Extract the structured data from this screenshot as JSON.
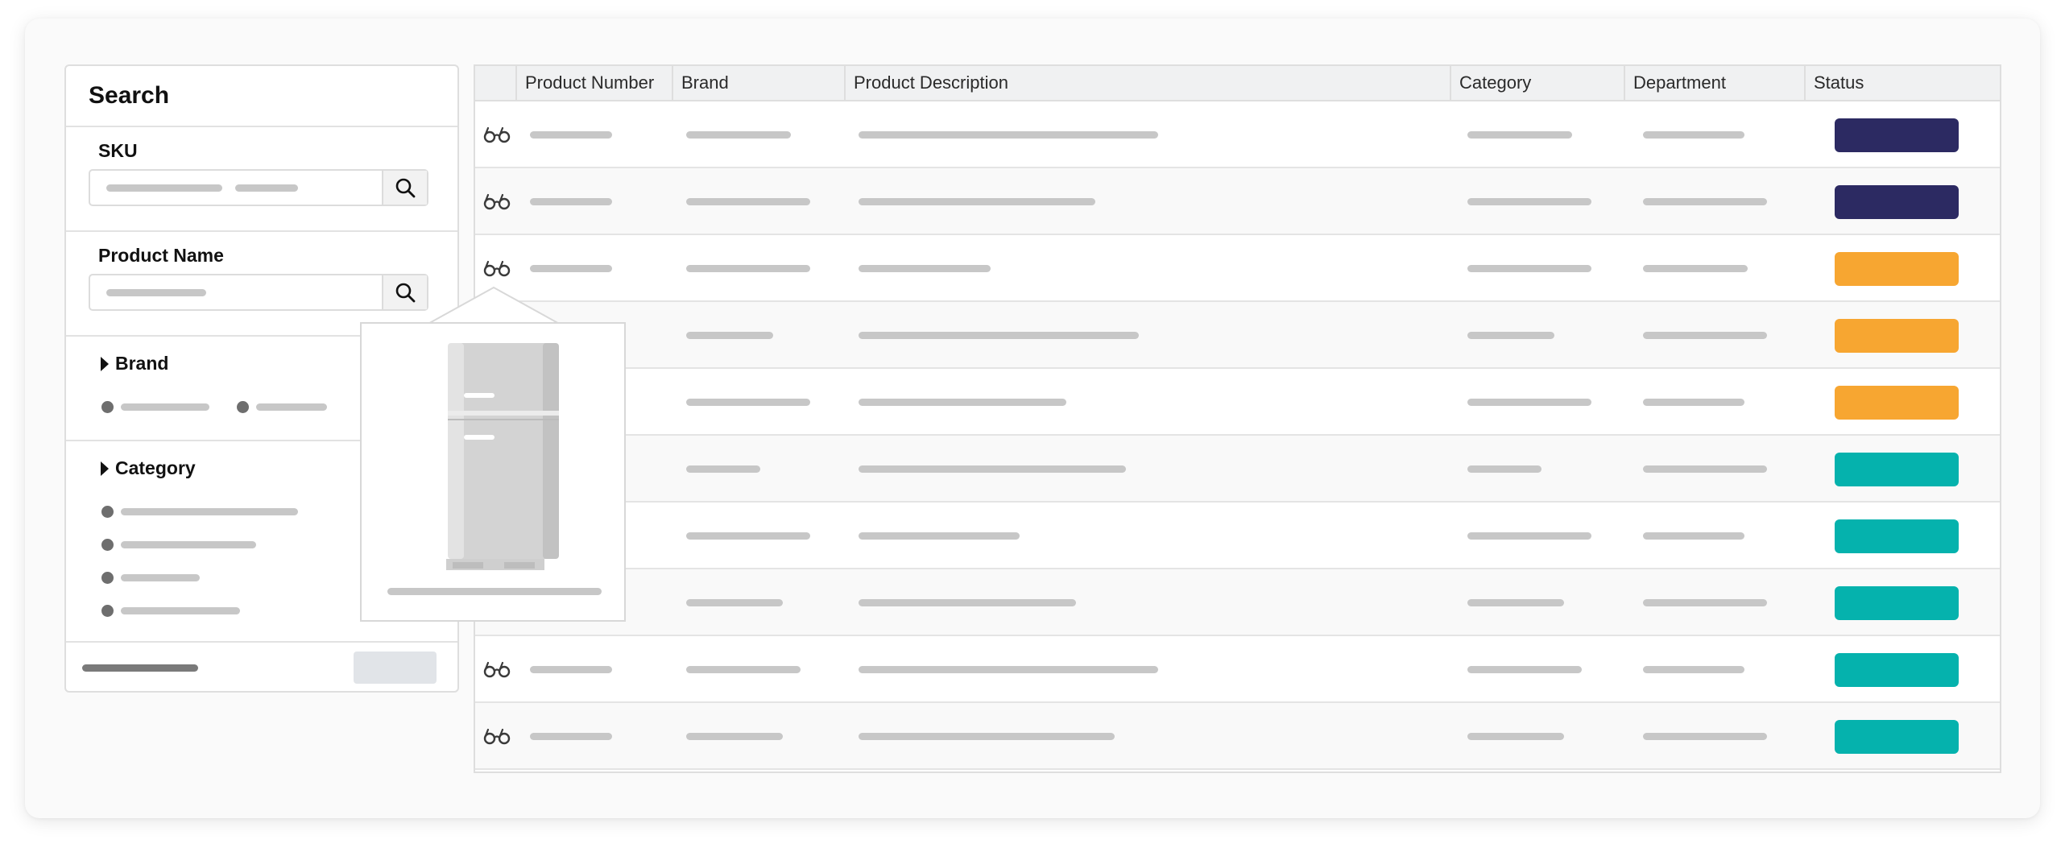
{
  "search": {
    "title": "Search",
    "sku_label": "SKU",
    "product_name_label": "Product Name",
    "brand_label": "Brand",
    "category_label": "Category"
  },
  "table": {
    "columns": [
      "",
      "Product Number",
      "Brand",
      "Product Description",
      "Category",
      "Department",
      "Status"
    ],
    "rows": [
      {
        "status": "navy"
      },
      {
        "status": "navy"
      },
      {
        "status": "orange"
      },
      {
        "status": "orange"
      },
      {
        "status": "orange"
      },
      {
        "status": "teal"
      },
      {
        "status": "teal"
      },
      {
        "status": "teal"
      },
      {
        "status": "teal"
      },
      {
        "status": "teal"
      }
    ]
  },
  "colors": {
    "navy": "#2c2a62",
    "orange": "#f7a631",
    "teal": "#05b2ad"
  },
  "icons": {
    "row": "glasses-icon",
    "search": "search-icon",
    "popover": "refrigerator-icon",
    "disclosure": "caret-right-icon"
  }
}
